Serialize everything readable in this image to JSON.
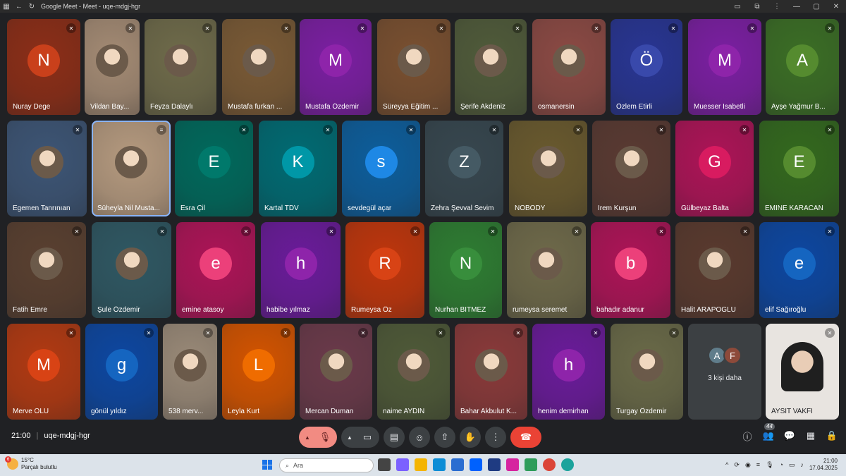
{
  "window": {
    "title": "Google Meet - Meet - uqe-mdgj-hgr"
  },
  "tiles": [
    {
      "name": "Nuray Dege",
      "initial": "N",
      "bg": "#8c2e17",
      "avatar": "#c9401b"
    },
    {
      "name": "Vildan Bay...",
      "initial": "",
      "bg": "#a48b74",
      "avatar": ""
    },
    {
      "name": "Feyza Dalaylı",
      "initial": "",
      "bg": "#6f6b4a",
      "avatar": ""
    },
    {
      "name": "Mustafa furkan ...",
      "initial": "",
      "bg": "#7a5a35",
      "avatar": ""
    },
    {
      "name": "Mustafa Özdemir",
      "initial": "M",
      "bg": "#7b1fa2",
      "avatar": "#8e24aa"
    },
    {
      "name": "Süreyya Eğitim ...",
      "initial": "",
      "bg": "#7a5030",
      "avatar": ""
    },
    {
      "name": "Şerife Akdeniz",
      "initial": "",
      "bg": "#505b3a",
      "avatar": ""
    },
    {
      "name": "osmanersin",
      "initial": "",
      "bg": "#8c4a44",
      "avatar": ""
    },
    {
      "name": "Özlem Etirli",
      "initial": "Ö",
      "bg": "#283593",
      "avatar": "#3949ab"
    },
    {
      "name": "Muesser Isabetli",
      "initial": "M",
      "bg": "#7b1fa2",
      "avatar": "#8e24aa"
    },
    {
      "name": "Ayşe Yağmur B...",
      "initial": "A",
      "bg": "#3b6e25",
      "avatar": "#558b2f"
    },
    {
      "name": "Egemen Tanrınıan",
      "initial": "",
      "bg": "#3d5575",
      "avatar": ""
    },
    {
      "name": "Süheyla Nil Musta...",
      "initial": "",
      "bg": "#b59a7f",
      "avatar": ""
    },
    {
      "name": "Esra Çil",
      "initial": "E",
      "bg": "#00695c",
      "avatar": "#00796b"
    },
    {
      "name": "Kartal TDV",
      "initial": "K",
      "bg": "#006b73",
      "avatar": "#0097a7"
    },
    {
      "name": "sevdegül açar",
      "initial": "s",
      "bg": "#0d5e9c",
      "avatar": "#1e88e5"
    },
    {
      "name": "Zehra Şevval Sevim",
      "initial": "Z",
      "bg": "#37474f",
      "avatar": "#455a64"
    },
    {
      "name": "NOBODY",
      "initial": "",
      "bg": "#6a5a2e",
      "avatar": ""
    },
    {
      "name": "İrem Kurşun",
      "initial": "",
      "bg": "#5a3a32",
      "avatar": ""
    },
    {
      "name": "Gülbeyaz Balta",
      "initial": "G",
      "bg": "#ad1457",
      "avatar": "#d81b60"
    },
    {
      "name": "EMİNE KARACAN",
      "initial": "E",
      "bg": "#33691e",
      "avatar": "#558b2f"
    },
    {
      "name": "Fatih Emre",
      "initial": "",
      "bg": "#5a4030",
      "avatar": ""
    },
    {
      "name": "Şule Özdemir",
      "initial": "",
      "bg": "#2f5863",
      "avatar": ""
    },
    {
      "name": "emine atasoy",
      "initial": "e",
      "bg": "#ad1457",
      "avatar": "#ec407a"
    },
    {
      "name": "habibe yılmaz",
      "initial": "h",
      "bg": "#6a1b9a",
      "avatar": "#8e24aa"
    },
    {
      "name": "Rumeysa Öz",
      "initial": "R",
      "bg": "#bf360c",
      "avatar": "#d84315"
    },
    {
      "name": "Nurhan BİTMEZ",
      "initial": "N",
      "bg": "#2e7d32",
      "avatar": "#388e3c"
    },
    {
      "name": "rumeysa seremet",
      "initial": "",
      "bg": "#6f6a4a",
      "avatar": ""
    },
    {
      "name": "bahadır adanur",
      "initial": "b",
      "bg": "#ad1457",
      "avatar": "#ec407a"
    },
    {
      "name": "Halit ARAPOGLU",
      "initial": "",
      "bg": "#5a3a2e",
      "avatar": ""
    },
    {
      "name": "elif Sağıroğlu",
      "initial": "e",
      "bg": "#0d47a1",
      "avatar": "#1565c0"
    },
    {
      "name": "Merve OLU",
      "initial": "M",
      "bg": "#b23a12",
      "avatar": "#d84315"
    },
    {
      "name": "gönül yıldız",
      "initial": "g",
      "bg": "#0d47a1",
      "avatar": "#1565c0"
    },
    {
      "name": "538 merv...",
      "initial": "",
      "bg": "#9a8a78",
      "avatar": ""
    },
    {
      "name": "Leyla Kurt",
      "initial": "L",
      "bg": "#d35400",
      "avatar": "#ef6c00"
    },
    {
      "name": "Mercan Duman",
      "initial": "",
      "bg": "#6b3a4a",
      "avatar": ""
    },
    {
      "name": "naime AYDIN",
      "initial": "",
      "bg": "#4f5a38",
      "avatar": ""
    },
    {
      "name": "Bahar Akbulut K...",
      "initial": "",
      "bg": "#8a3a3a",
      "avatar": ""
    },
    {
      "name": "henim demirhan",
      "initial": "h",
      "bg": "#6a1b9a",
      "avatar": "#8e24aa"
    },
    {
      "name": "Turgay Özdemir",
      "initial": "",
      "bg": "#6a6a48",
      "avatar": ""
    }
  ],
  "more_tile": {
    "label": "3 kişi daha",
    "initials": [
      "A",
      "F"
    ],
    "colors": [
      "#607d8b",
      "#8d4a3a"
    ]
  },
  "self_tile": {
    "name": "AYSİT VAKFI",
    "bg": "#e8e4e0"
  },
  "controls": {
    "time": "21:00",
    "meeting_code": "uqe-mdgj-hgr",
    "participant_count": "44"
  },
  "taskbar": {
    "weather_temp": "15°C",
    "weather_desc": "Parçalı bulutlu",
    "weather_badge": "6",
    "search_placeholder": "Ara",
    "time": "21:00",
    "date": "17.04.2025"
  }
}
